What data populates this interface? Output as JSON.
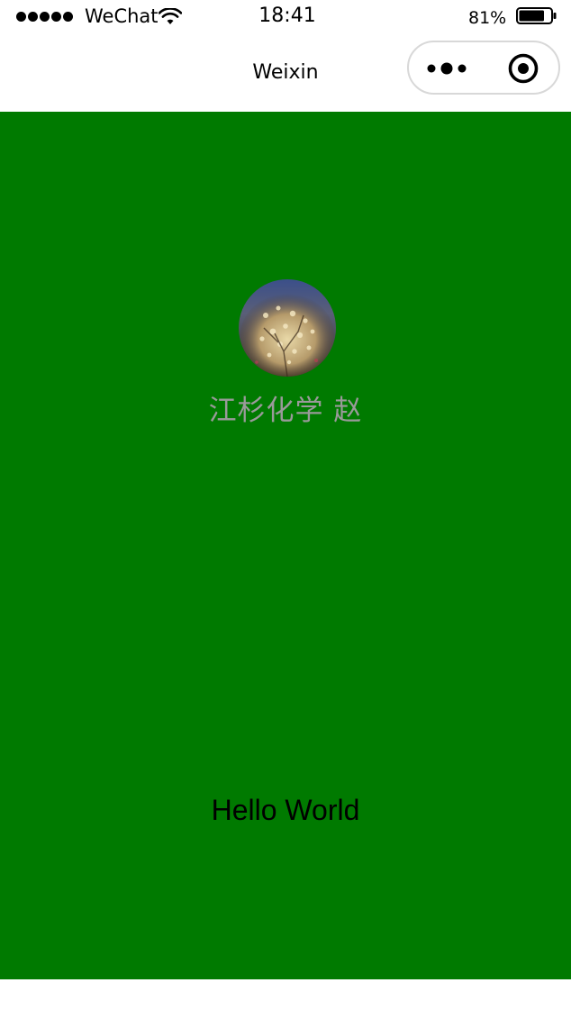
{
  "status_bar": {
    "carrier": "WeChat",
    "time": "18:41",
    "battery_percent": "81%",
    "battery_level": 0.81,
    "signal_bars": 5
  },
  "nav_bar": {
    "title": "Weixin",
    "menu_icon": "more-dots-icon",
    "close_icon": "target-circle-icon"
  },
  "profile": {
    "nickname": "江杉化学 赵"
  },
  "main": {
    "motto": "Hello World"
  },
  "colors": {
    "content_background": "#007a00",
    "nickname_text": "#9a9a9a",
    "nav_background": "#ffffff"
  }
}
